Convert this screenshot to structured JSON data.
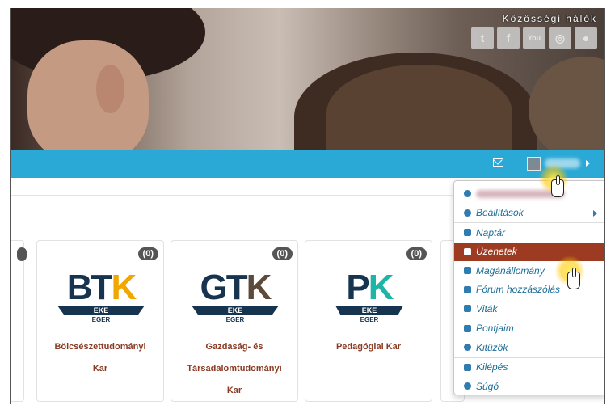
{
  "social": {
    "title": "Közösségi hálók",
    "icons": [
      {
        "name": "twitter-icon",
        "glyph": "t"
      },
      {
        "name": "facebook-icon",
        "glyph": "f"
      },
      {
        "name": "youtube-icon",
        "glyph": "You"
      },
      {
        "name": "instagram-icon",
        "glyph": "◎"
      },
      {
        "name": "globe-icon",
        "glyph": "●"
      }
    ]
  },
  "cards": [
    {
      "badge": "(0)",
      "logo_main": "BT",
      "logo_accent": "K",
      "logo_bar": "EKE",
      "logo_sub": "EGER",
      "name_lines": [
        "Bölcsészettudományi",
        "Kar"
      ],
      "accent_color": "#f2a600"
    },
    {
      "badge": "(0)",
      "logo_main": "GT",
      "logo_accent": "K",
      "logo_bar": "EKE",
      "logo_sub": "EGER",
      "name_lines": [
        "Gazdaság- és",
        "Társadalomtudományi",
        "Kar"
      ],
      "accent_color": "#5c4a3a"
    },
    {
      "badge": "(0)",
      "logo_main": "P",
      "logo_accent": "K",
      "logo_bar": "EKE",
      "logo_sub": "EGER",
      "name_lines": [
        "Pedagógiai Kar"
      ],
      "accent_color": "#1fb5a6"
    }
  ],
  "menu": {
    "settings": "Beállítások",
    "calendar": "Naptár",
    "messages": "Üzenetek",
    "private_files": "Magánállomány",
    "forum_posts": "Fórum hozzászólás",
    "discussions": "Viták",
    "grades": "Pontjaim",
    "badges": "Kitűzők",
    "logout": "Kilépés",
    "help": "Súgó"
  },
  "colors": {
    "navbar": "#2aa8d6",
    "active_item": "#9c3b22",
    "menu_text": "#1c6d96",
    "card_title": "#8a3a22"
  }
}
